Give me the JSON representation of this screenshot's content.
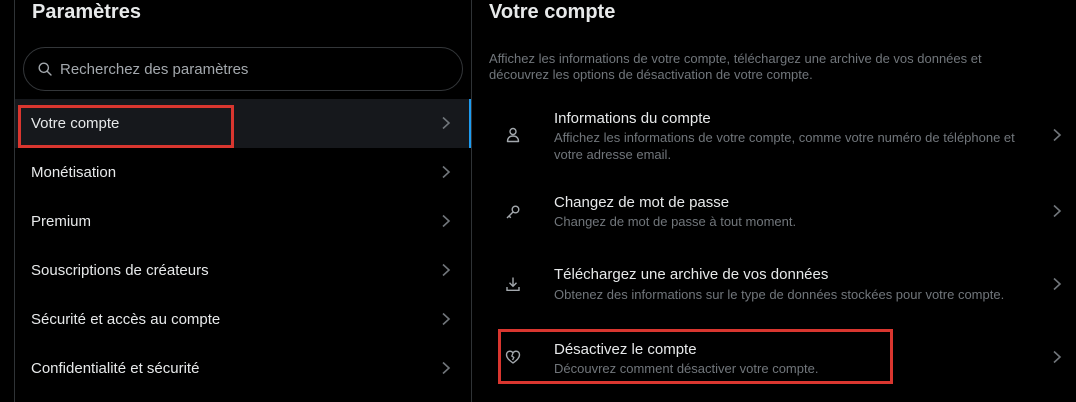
{
  "left": {
    "title": "Paramètres",
    "search_placeholder": "Recherchez des paramètres",
    "items": [
      {
        "label": "Votre compte",
        "active": true
      },
      {
        "label": "Monétisation"
      },
      {
        "label": "Premium"
      },
      {
        "label": "Souscriptions de créateurs"
      },
      {
        "label": "Sécurité et accès au compte"
      },
      {
        "label": "Confidentialité et sécurité"
      }
    ]
  },
  "right": {
    "title": "Votre compte",
    "description": "Affichez les informations de votre compte, téléchargez une archive de vos données et découvrez les options de désactivation de votre compte.",
    "options": [
      {
        "icon": "person-icon",
        "title": "Informations du compte",
        "subtitle": "Affichez les informations de votre compte, comme votre numéro de téléphone et votre adresse email."
      },
      {
        "icon": "key-icon",
        "title": "Changez de mot de passe",
        "subtitle": "Changez de mot de passe à tout moment."
      },
      {
        "icon": "download-icon",
        "title": "Téléchargez une archive de vos données",
        "subtitle": "Obtenez des informations sur le type de données stockées pour votre compte."
      },
      {
        "icon": "broken-heart-icon",
        "title": "Désactivez le compte",
        "subtitle": "Découvrez comment désactiver votre compte."
      }
    ]
  },
  "colors": {
    "background": "#000000",
    "text_primary": "#e7e9ea",
    "text_secondary": "#71767b",
    "accent": "#1d9bf0",
    "highlight_box": "#d9362f",
    "active_row": "#16181c"
  }
}
